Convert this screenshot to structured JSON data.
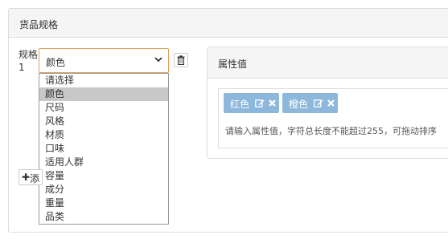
{
  "panel": {
    "title": "货品规格"
  },
  "spec": {
    "label": "规格\n1",
    "select": {
      "value": "颜色",
      "options": [
        "请选择",
        "颜色",
        "尺码",
        "风格",
        "材质",
        "口味",
        "适用人群",
        "容量",
        "成分",
        "重量",
        "品类"
      ],
      "selected_index": 1
    },
    "add_button_label": "添"
  },
  "attributes": {
    "title": "属性值",
    "tags": [
      {
        "label": "红色"
      },
      {
        "label": "橙色"
      }
    ],
    "hint": "请输入属性值，字符总长度不能超过255，可拖动排序"
  },
  "icons": {
    "caret": "chevron-down-icon",
    "delete": "trash-icon",
    "add": "plus-icon",
    "edit": "edit-icon",
    "remove": "close-icon"
  },
  "colors": {
    "tag_background": "#8db8dc",
    "select_focus_border": "#e0a060",
    "selected_option": "#c8c8c8"
  }
}
